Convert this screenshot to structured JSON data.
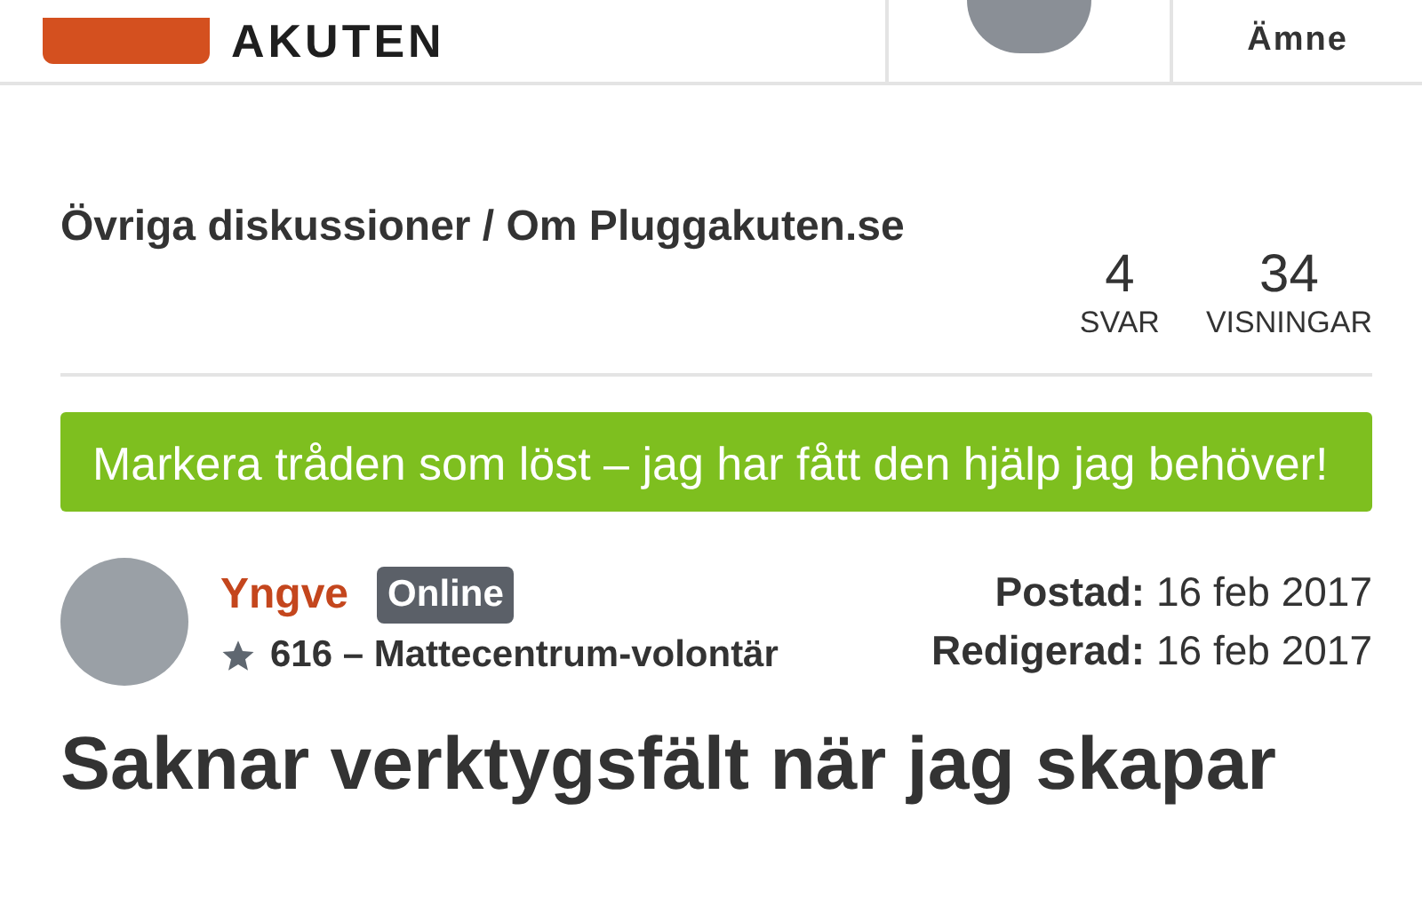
{
  "header": {
    "logo_text": "AKUTEN",
    "menu_label": "Ämne"
  },
  "breadcrumb": "Övriga diskussioner / Om Pluggakuten.se",
  "stats": [
    {
      "value": "4",
      "label": "SVAR"
    },
    {
      "value": "34",
      "label": "VISNINGAR"
    }
  ],
  "solved_banner": "Markera tråden som löst – jag har fått den hjälp jag behöver!",
  "author": {
    "name": "Yngve",
    "status": "Online",
    "rank": "616 – Mattecentrum-volontär"
  },
  "dates": [
    "**Postad:** 16 feb 2017",
    "**Redigerad:** 16 feb 2017"
  ],
  "post_title": "Saknar verktygsfält när jag skapar"
}
